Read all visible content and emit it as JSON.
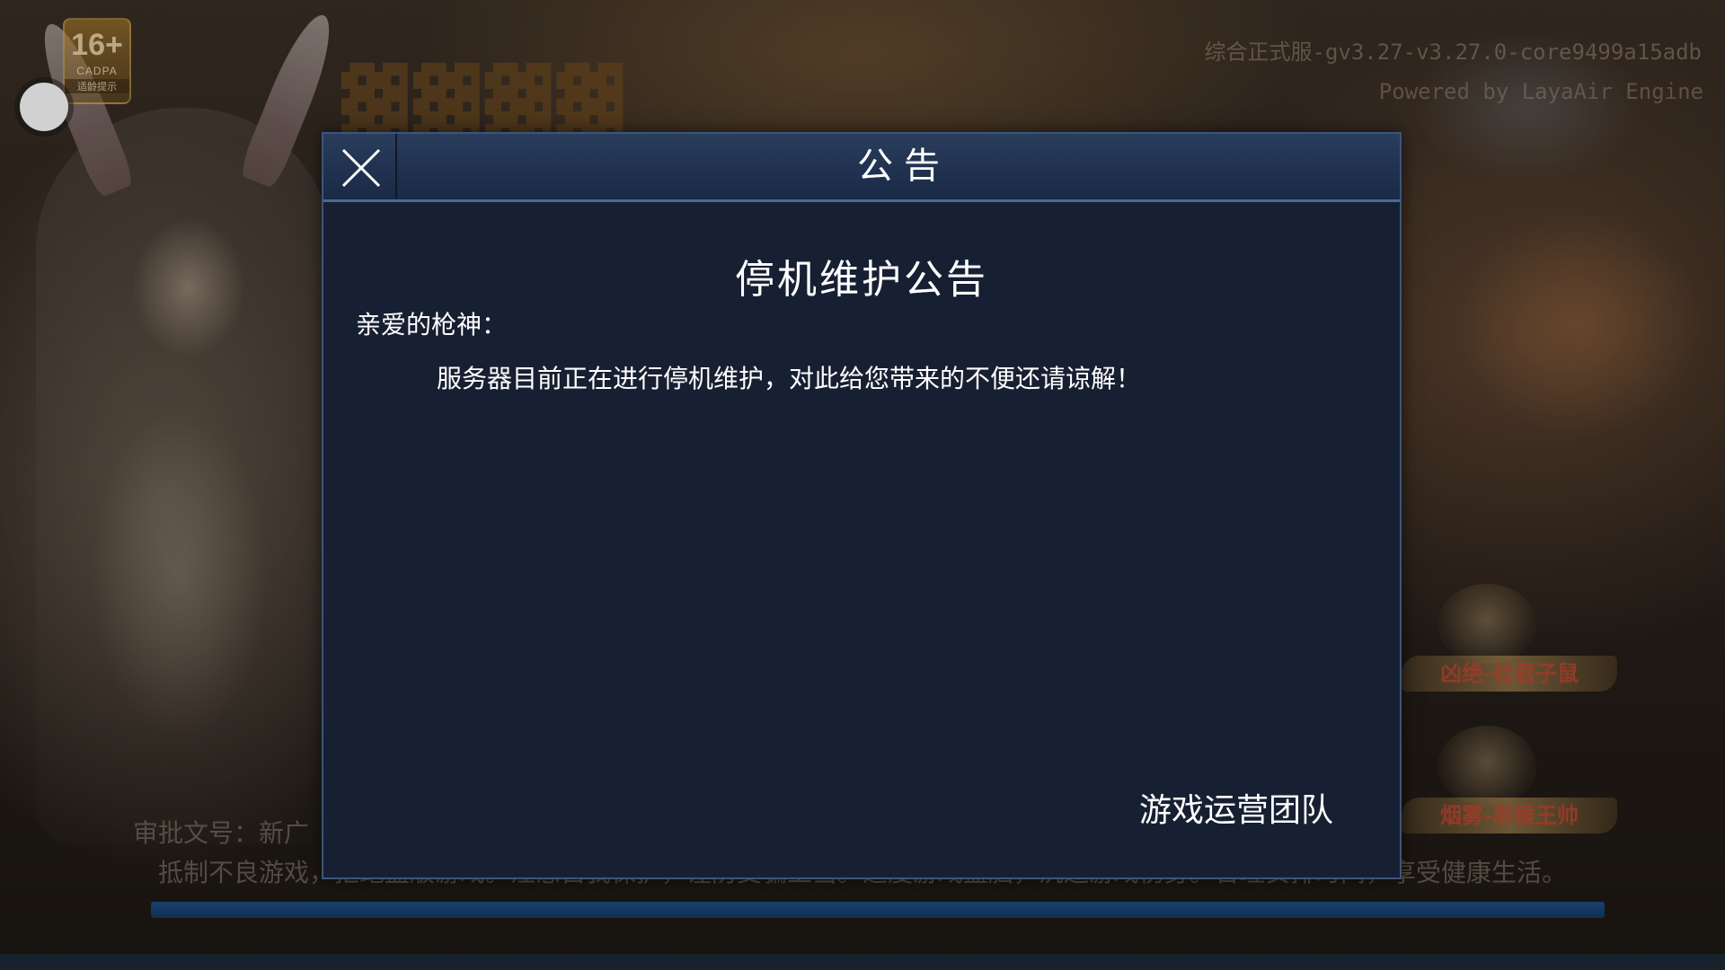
{
  "background": {
    "age_rating": "16+",
    "age_rating_org": "CADPA",
    "age_rating_hint": "适龄提示",
    "version": "综合正式服-gv3.27-v3.27.0-core9499a15adb",
    "powered_by": "Powered by LayaAir Engine",
    "hero_cards": [
      {
        "label": "凶绝-社君子鼠"
      },
      {
        "label": "烟雾-串猴王帅"
      }
    ],
    "approval_text": "审批文号：新广",
    "anti_addiction_text": "抵制不良游戏，拒绝盗版游戏。注意自我保护，谨防受骗上当。适度游戏益脑，沉迷游戏伤身。合理安排时间，享受健康生活。",
    "loading_progress_percent": 100
  },
  "dialog": {
    "title": "公告",
    "notice_title": "停机维护公告",
    "greeting": "亲爱的枪神：",
    "content": "服务器目前正在进行停机维护，对此给您带来的不便还请谅解！",
    "signature": "游戏运营团队"
  },
  "colors": {
    "dialog_bg": "#172032",
    "dialog_border": "#3c557a",
    "header_bg": "#203250",
    "progress": "#1d4f86"
  }
}
